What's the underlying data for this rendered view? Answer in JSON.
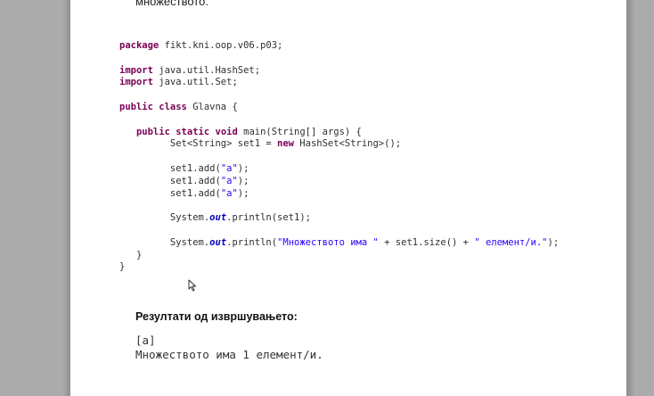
{
  "document": {
    "top_text": "множеството.",
    "code": {
      "package_kw": "package",
      "package_name": " fikt.kni.oop.v06.p03;",
      "import_kw": "import",
      "import1": " java.util.HashSet;",
      "import2": " java.util.Set;",
      "class_kw1": "public",
      "class_kw2": "class",
      "class_name": " Glavna {",
      "main_kw1": "public",
      "main_kw2": "static",
      "main_kw3": "void",
      "main_sig": " main(String[] args) {",
      "decl_start": "Set<String> set1 = ",
      "new_kw": "new",
      "decl_end": " HashSet<String>();",
      "add_call": "set1.add(",
      "add_arg": "\"a\"",
      "add_end": ");",
      "print1_start": "System.",
      "out_field": "out",
      "print1_end": ".println(set1);",
      "print2_mid": ".println(",
      "print2_str1": "\"Множеството има \"",
      "print2_plus1": " + set1.size() + ",
      "print2_str2": "\" елемент/и.\"",
      "print2_end": ");",
      "close_method": "}",
      "close_class": "}"
    },
    "result_heading": "Резултати од извршувањето:",
    "output_line1": "[a]",
    "output_line2": "Множеството има 1 елемент/и."
  }
}
